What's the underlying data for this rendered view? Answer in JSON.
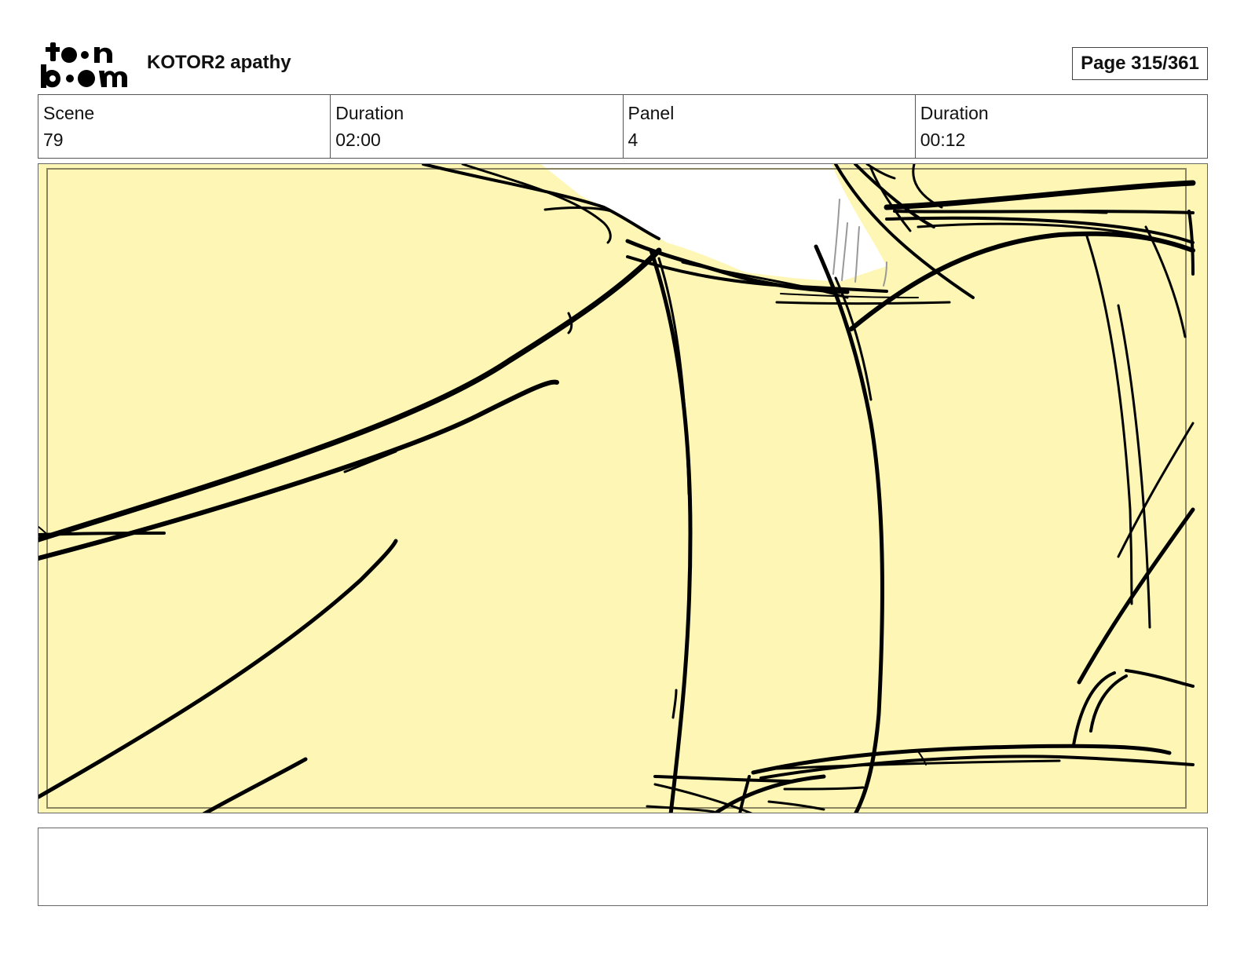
{
  "header": {
    "logo_alt": "toon boom",
    "project_title": "KOTOR2 apathy",
    "page_indicator": "Page 315/361"
  },
  "info": {
    "scene_label": "Scene",
    "scene_value": "79",
    "scene_duration_label": "Duration",
    "scene_duration_value": "02:00",
    "panel_label": "Panel",
    "panel_value": "4",
    "panel_duration_label": "Duration",
    "panel_duration_value": "00:12"
  },
  "panel": {
    "fill_color": "#fdf6b4",
    "line_color": "#000000",
    "sky_color": "#ffffff"
  },
  "notes": {
    "text": ""
  }
}
